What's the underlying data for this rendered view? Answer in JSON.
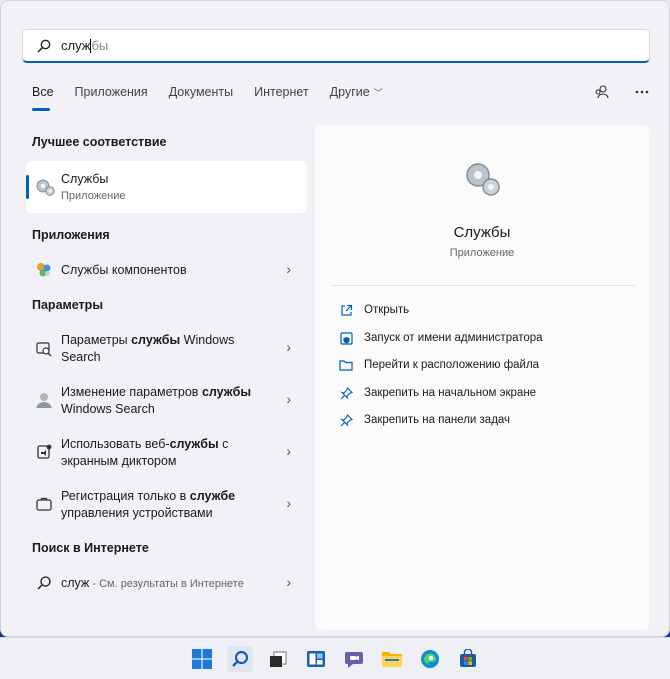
{
  "search": {
    "typed": "служ",
    "suggested_rest": "бы"
  },
  "tabs": [
    {
      "label": "Все"
    },
    {
      "label": "Приложения"
    },
    {
      "label": "Документы"
    },
    {
      "label": "Интернет"
    },
    {
      "label": "Другие"
    }
  ],
  "sections": {
    "best_match": "Лучшее соответствие",
    "apps": "Приложения",
    "settings": "Параметры",
    "web": "Поиск в Интернете"
  },
  "best_match": {
    "name": "Службы",
    "type": "Приложение"
  },
  "apps": [
    {
      "label": "Службы компонентов"
    }
  ],
  "settings": [
    {
      "pre": "Параметры ",
      "bold": "службы",
      "post": " Windows Search"
    },
    {
      "pre": "Изменение параметров ",
      "bold": "службы",
      "post": " Windows Search"
    },
    {
      "pre": "Использовать веб-",
      "bold": "службы",
      "post": " с экранным диктором"
    },
    {
      "pre": "Регистрация только в ",
      "bold": "службе",
      "post": " управления устройствами"
    }
  ],
  "web": {
    "query": "служ",
    "suffix": " - См. результаты в Интернете"
  },
  "preview": {
    "name": "Службы",
    "type": "Приложение",
    "actions": [
      {
        "label": "Открыть",
        "icon": "open-icon"
      },
      {
        "label": "Запуск от имени администратора",
        "icon": "shield-icon"
      },
      {
        "label": "Перейти к расположению файла",
        "icon": "folder-icon"
      },
      {
        "label": "Закрепить на начальном экране",
        "icon": "pin-icon"
      },
      {
        "label": "Закрепить на панели задач",
        "icon": "pin-icon"
      }
    ]
  },
  "colors": {
    "accent": "#005fb8"
  }
}
